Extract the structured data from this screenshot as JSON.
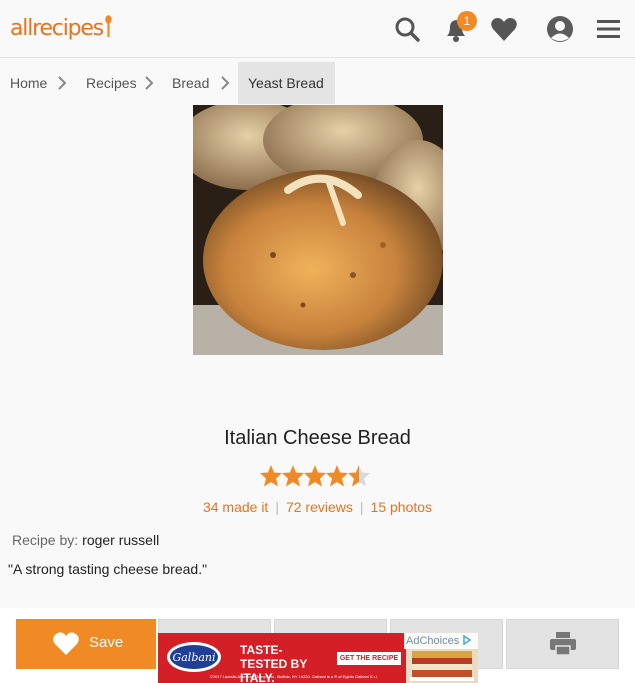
{
  "brand": {
    "name": "allrecipes",
    "accent": "#e8731e",
    "badge_color": "#f08a24"
  },
  "header": {
    "icons": [
      "search-icon",
      "bell-icon",
      "heart-icon",
      "user-icon",
      "menu-icon"
    ],
    "notification_count": "1"
  },
  "breadcrumb": {
    "items": [
      "Home",
      "Recipes",
      "Bread",
      "Yeast Bread"
    ]
  },
  "recipe": {
    "title": "Italian Cheese Bread",
    "rating": 4.5,
    "made_it": "34 made it",
    "reviews": "72 reviews",
    "photos": "15 photos",
    "by_label": "Recipe by:",
    "author": "roger russell",
    "description": "\"A strong tasting cheese bread.\""
  },
  "actions": {
    "save_label": "Save",
    "print_icon": "printer-icon"
  },
  "ad": {
    "brand": "Galbani",
    "headline": "TASTE-TESTED BY ITALY.",
    "cta": "GET THE RECIPE ▶",
    "adchoices": "AdChoices",
    "legal": "©2017 Lactalis American Group, Inc., Buffalo, NY 14220. Galbani is a ® of Egidio Galbani S.r.l."
  }
}
